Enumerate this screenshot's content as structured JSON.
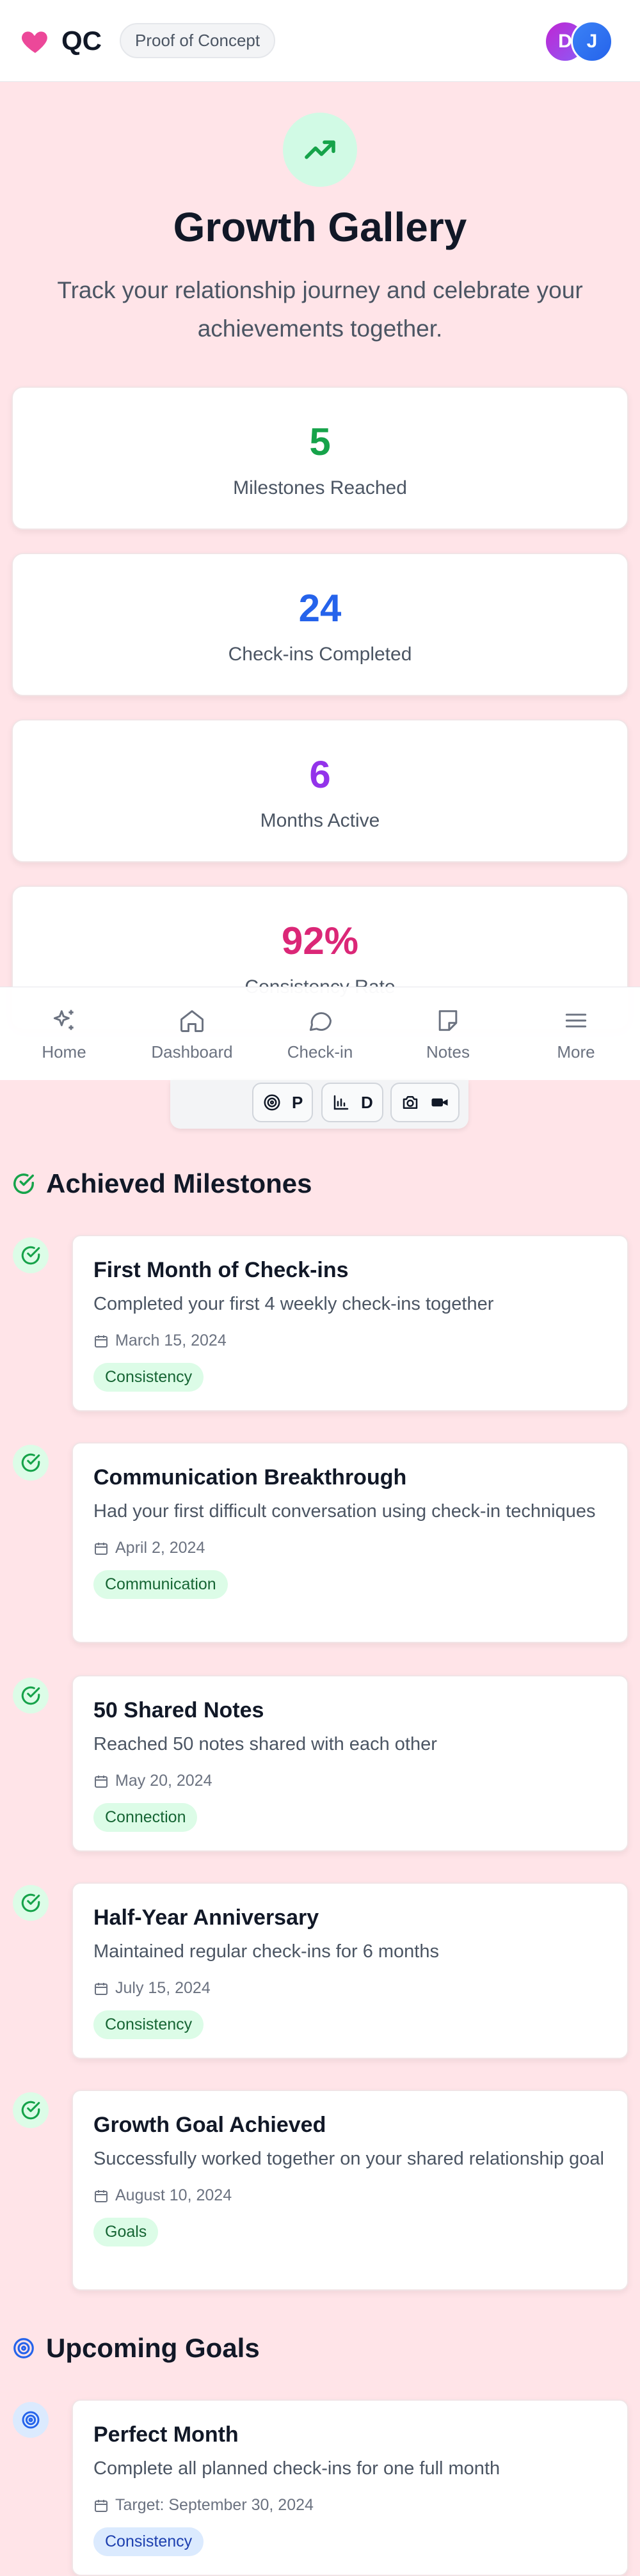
{
  "header": {
    "logo_text": "QC",
    "badge": "Proof of Concept",
    "avatars": [
      "D",
      "J"
    ]
  },
  "hero": {
    "title": "Growth Gallery",
    "subtitle": "Track your relationship journey and celebrate your achievements together."
  },
  "stats": [
    {
      "value": "5",
      "label": "Milestones Reached",
      "color": "#16a34a"
    },
    {
      "value": "24",
      "label": "Check-ins Completed",
      "color": "#2563eb"
    },
    {
      "value": "6",
      "label": "Months Active",
      "color": "#9333ea"
    },
    {
      "value": "92%",
      "label": "Consistency Rate",
      "color": "#db2777"
    }
  ],
  "nav": {
    "items": [
      {
        "label": "Home",
        "icon": "sparkles-icon"
      },
      {
        "label": "Dashboard",
        "icon": "house-icon"
      },
      {
        "label": "Check-in",
        "icon": "chat-bubble-icon"
      },
      {
        "label": "Notes",
        "icon": "sticky-note-icon"
      },
      {
        "label": "More",
        "icon": "menu-icon"
      }
    ]
  },
  "toolbar": {
    "group1_label": "P",
    "group2_label": "D"
  },
  "achieved": {
    "title": "Achieved Milestones",
    "items": [
      {
        "title": "First Month of Check-ins",
        "desc": "Completed your first 4 weekly check-ins together",
        "date": "March 15, 2024",
        "tag": "Consistency"
      },
      {
        "title": "Communication Breakthrough",
        "desc": "Had your first difficult conversation using check-in techniques",
        "date": "April 2, 2024",
        "tag": "Communication"
      },
      {
        "title": "50 Shared Notes",
        "desc": "Reached 50 notes shared with each other",
        "date": "May 20, 2024",
        "tag": "Connection"
      },
      {
        "title": "Half-Year Anniversary",
        "desc": "Maintained regular check-ins for 6 months",
        "date": "July 15, 2024",
        "tag": "Consistency"
      },
      {
        "title": "Growth Goal Achieved",
        "desc": "Successfully worked together on your shared relationship goal",
        "date": "August 10, 2024",
        "tag": "Goals"
      }
    ]
  },
  "upcoming": {
    "title": "Upcoming Goals",
    "items": [
      {
        "title": "Perfect Month",
        "desc": "Complete all planned check-ins for one full month",
        "date": "Target: September 30, 2024",
        "tag": "Consistency"
      }
    ]
  },
  "colors": {
    "accent_pink": "#ec4899",
    "success_green": "#16a34a",
    "goal_blue": "#2563eb"
  }
}
